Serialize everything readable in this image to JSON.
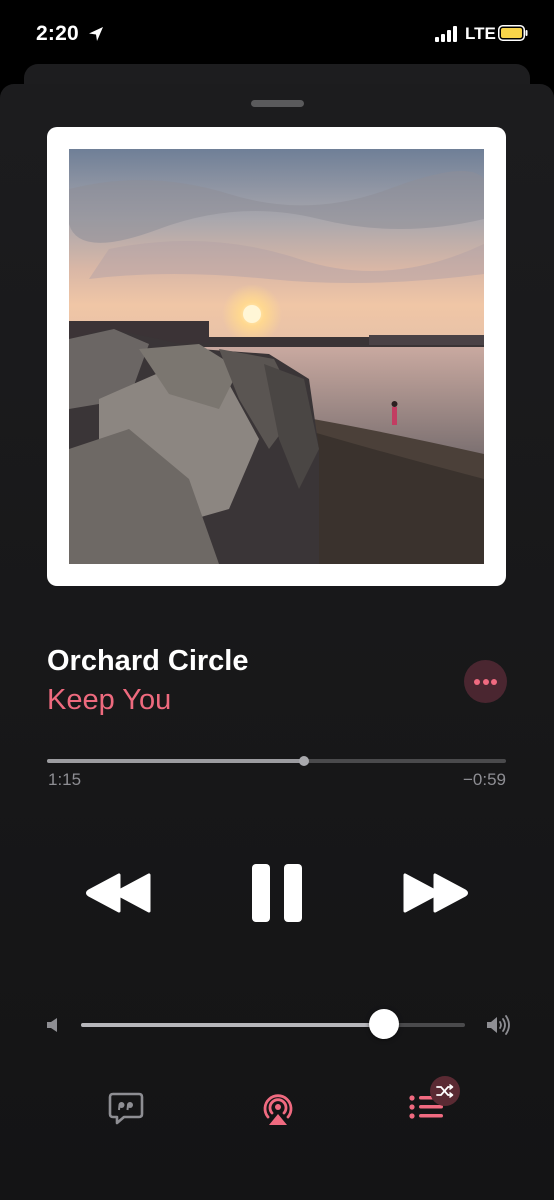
{
  "status_bar": {
    "time": "2:20",
    "network": "LTE",
    "icons": [
      "location-arrow-icon",
      "cellular-signal-icon",
      "battery-icon"
    ],
    "battery_color": "#f8d44a"
  },
  "now_playing": {
    "title": "Orchard Circle",
    "artist": "Keep You",
    "artwork": "sunset over rocky shoreline",
    "more_icon": "ellipsis-icon"
  },
  "progress": {
    "elapsed": "1:15",
    "remaining": "−0:59",
    "fraction": 0.56
  },
  "controls": {
    "previous_icon": "rewind-icon",
    "play_pause_icon": "pause-icon",
    "next_icon": "fast-forward-icon"
  },
  "volume": {
    "level": 0.79,
    "low_icon": "speaker-low-icon",
    "high_icon": "speaker-high-icon"
  },
  "bottom_bar": {
    "lyrics_icon": "lyrics-quote-bubble-icon",
    "airplay_icon": "airplay-icon",
    "queue_icon": "playing-next-queue-icon",
    "shuffle_icon": "shuffle-icon"
  },
  "colors": {
    "accent": "#f06a80",
    "background": "#1c1c1e"
  }
}
